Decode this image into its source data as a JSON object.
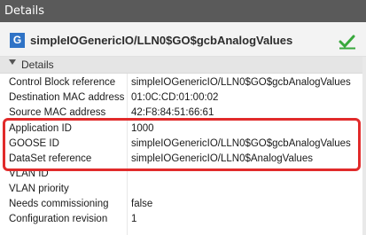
{
  "window": {
    "title": "Details"
  },
  "header": {
    "icon_letter": "G",
    "title": "simpleIOGenericIO/LLN0$GO$gcbAnalogValues",
    "status_icon": "check-icon"
  },
  "group": {
    "title": "Details",
    "collapse_icon": "chevron-down-icon"
  },
  "properties": [
    {
      "label": "Control Block reference",
      "value": "simpleIOGenericIO/LLN0$GO$gcbAnalogValues"
    },
    {
      "label": "Destination MAC address",
      "value": "01:0C:CD:01:00:02"
    },
    {
      "label": "Source MAC address",
      "value": "42:F8:84:51:66:61"
    },
    {
      "label": "Application ID",
      "value": "1000"
    },
    {
      "label": "GOOSE ID",
      "value": "simpleIOGenericIO/LLN0$GO$gcbAnalogValues"
    },
    {
      "label": "DataSet reference",
      "value": "simpleIOGenericIO/LLN0$AnalogValues"
    },
    {
      "label": "VLAN ID",
      "value": ""
    },
    {
      "label": "VLAN priority",
      "value": ""
    },
    {
      "label": "Needs commissioning",
      "value": "false"
    },
    {
      "label": "Configuration revision",
      "value": "1"
    }
  ],
  "colors": {
    "highlight": "#e12b2b",
    "accent": "#2f73c6",
    "topbar": "#5a5a5a"
  }
}
